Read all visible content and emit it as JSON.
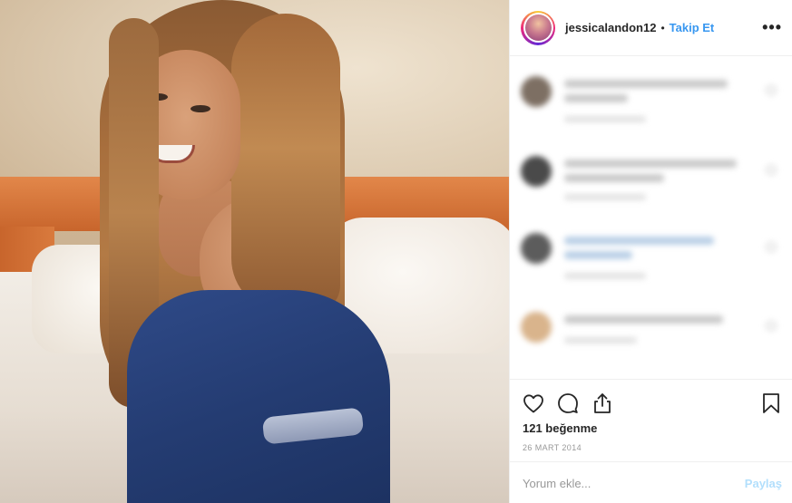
{
  "post": {
    "photo_icon": "portrait-photo"
  },
  "header": {
    "username": "jessicalandon12",
    "separator": "•",
    "follow_label": "Takip Et",
    "more_icon": "more-horizontal-icon",
    "more_label": "•••"
  },
  "comments": {
    "note": "",
    "count_visible": 4
  },
  "actions": {
    "like_icon": "heart-icon",
    "comment_icon": "comment-bubble-icon",
    "share_icon": "share-icon",
    "save_icon": "bookmark-icon",
    "likes_text": "121 beğenme",
    "date_text": "26 MART 2014"
  },
  "comment_box": {
    "placeholder": "Yorum ekle...",
    "share_label": "Paylaş"
  },
  "colors": {
    "accent": "#3897f0",
    "share_disabled": "#b2dffc",
    "text": "#262626",
    "muted": "#999999"
  }
}
